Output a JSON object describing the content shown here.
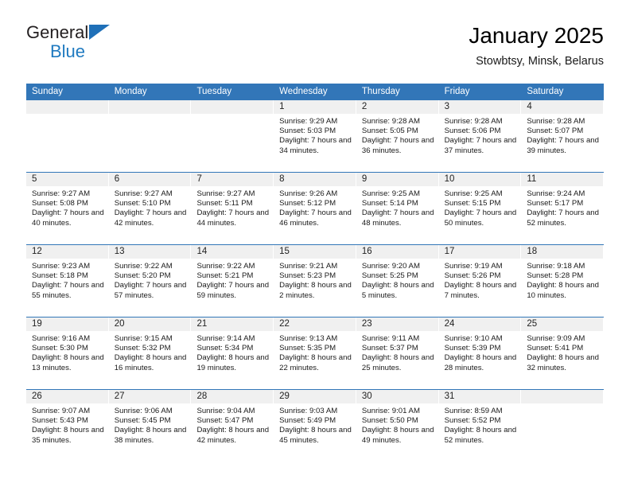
{
  "brand": {
    "name_top": "General",
    "name_bottom": "Blue",
    "logo_icon": "triangle-flag-icon",
    "accent_color": "#1f7ac0"
  },
  "header": {
    "title": "January 2025",
    "subtitle": "Stowbtsy, Minsk, Belarus"
  },
  "colors": {
    "header_blue": "#3276b8",
    "daynum_band": "#f0f0f0",
    "text": "#1a1a1a"
  },
  "calendar": {
    "weekday_headers": [
      "Sunday",
      "Monday",
      "Tuesday",
      "Wednesday",
      "Thursday",
      "Friday",
      "Saturday"
    ],
    "weeks": [
      [
        {
          "day": "",
          "lines": []
        },
        {
          "day": "",
          "lines": []
        },
        {
          "day": "",
          "lines": []
        },
        {
          "day": "1",
          "lines": [
            "Sunrise: 9:29 AM",
            "Sunset: 5:03 PM",
            "Daylight: 7 hours and 34 minutes."
          ]
        },
        {
          "day": "2",
          "lines": [
            "Sunrise: 9:28 AM",
            "Sunset: 5:05 PM",
            "Daylight: 7 hours and 36 minutes."
          ]
        },
        {
          "day": "3",
          "lines": [
            "Sunrise: 9:28 AM",
            "Sunset: 5:06 PM",
            "Daylight: 7 hours and 37 minutes."
          ]
        },
        {
          "day": "4",
          "lines": [
            "Sunrise: 9:28 AM",
            "Sunset: 5:07 PM",
            "Daylight: 7 hours and 39 minutes."
          ]
        }
      ],
      [
        {
          "day": "5",
          "lines": [
            "Sunrise: 9:27 AM",
            "Sunset: 5:08 PM",
            "Daylight: 7 hours and 40 minutes."
          ]
        },
        {
          "day": "6",
          "lines": [
            "Sunrise: 9:27 AM",
            "Sunset: 5:10 PM",
            "Daylight: 7 hours and 42 minutes."
          ]
        },
        {
          "day": "7",
          "lines": [
            "Sunrise: 9:27 AM",
            "Sunset: 5:11 PM",
            "Daylight: 7 hours and 44 minutes."
          ]
        },
        {
          "day": "8",
          "lines": [
            "Sunrise: 9:26 AM",
            "Sunset: 5:12 PM",
            "Daylight: 7 hours and 46 minutes."
          ]
        },
        {
          "day": "9",
          "lines": [
            "Sunrise: 9:25 AM",
            "Sunset: 5:14 PM",
            "Daylight: 7 hours and 48 minutes."
          ]
        },
        {
          "day": "10",
          "lines": [
            "Sunrise: 9:25 AM",
            "Sunset: 5:15 PM",
            "Daylight: 7 hours and 50 minutes."
          ]
        },
        {
          "day": "11",
          "lines": [
            "Sunrise: 9:24 AM",
            "Sunset: 5:17 PM",
            "Daylight: 7 hours and 52 minutes."
          ]
        }
      ],
      [
        {
          "day": "12",
          "lines": [
            "Sunrise: 9:23 AM",
            "Sunset: 5:18 PM",
            "Daylight: 7 hours and 55 minutes."
          ]
        },
        {
          "day": "13",
          "lines": [
            "Sunrise: 9:22 AM",
            "Sunset: 5:20 PM",
            "Daylight: 7 hours and 57 minutes."
          ]
        },
        {
          "day": "14",
          "lines": [
            "Sunrise: 9:22 AM",
            "Sunset: 5:21 PM",
            "Daylight: 7 hours and 59 minutes."
          ]
        },
        {
          "day": "15",
          "lines": [
            "Sunrise: 9:21 AM",
            "Sunset: 5:23 PM",
            "Daylight: 8 hours and 2 minutes."
          ]
        },
        {
          "day": "16",
          "lines": [
            "Sunrise: 9:20 AM",
            "Sunset: 5:25 PM",
            "Daylight: 8 hours and 5 minutes."
          ]
        },
        {
          "day": "17",
          "lines": [
            "Sunrise: 9:19 AM",
            "Sunset: 5:26 PM",
            "Daylight: 8 hours and 7 minutes."
          ]
        },
        {
          "day": "18",
          "lines": [
            "Sunrise: 9:18 AM",
            "Sunset: 5:28 PM",
            "Daylight: 8 hours and 10 minutes."
          ]
        }
      ],
      [
        {
          "day": "19",
          "lines": [
            "Sunrise: 9:16 AM",
            "Sunset: 5:30 PM",
            "Daylight: 8 hours and 13 minutes."
          ]
        },
        {
          "day": "20",
          "lines": [
            "Sunrise: 9:15 AM",
            "Sunset: 5:32 PM",
            "Daylight: 8 hours and 16 minutes."
          ]
        },
        {
          "day": "21",
          "lines": [
            "Sunrise: 9:14 AM",
            "Sunset: 5:34 PM",
            "Daylight: 8 hours and 19 minutes."
          ]
        },
        {
          "day": "22",
          "lines": [
            "Sunrise: 9:13 AM",
            "Sunset: 5:35 PM",
            "Daylight: 8 hours and 22 minutes."
          ]
        },
        {
          "day": "23",
          "lines": [
            "Sunrise: 9:11 AM",
            "Sunset: 5:37 PM",
            "Daylight: 8 hours and 25 minutes."
          ]
        },
        {
          "day": "24",
          "lines": [
            "Sunrise: 9:10 AM",
            "Sunset: 5:39 PM",
            "Daylight: 8 hours and 28 minutes."
          ]
        },
        {
          "day": "25",
          "lines": [
            "Sunrise: 9:09 AM",
            "Sunset: 5:41 PM",
            "Daylight: 8 hours and 32 minutes."
          ]
        }
      ],
      [
        {
          "day": "26",
          "lines": [
            "Sunrise: 9:07 AM",
            "Sunset: 5:43 PM",
            "Daylight: 8 hours and 35 minutes."
          ]
        },
        {
          "day": "27",
          "lines": [
            "Sunrise: 9:06 AM",
            "Sunset: 5:45 PM",
            "Daylight: 8 hours and 38 minutes."
          ]
        },
        {
          "day": "28",
          "lines": [
            "Sunrise: 9:04 AM",
            "Sunset: 5:47 PM",
            "Daylight: 8 hours and 42 minutes."
          ]
        },
        {
          "day": "29",
          "lines": [
            "Sunrise: 9:03 AM",
            "Sunset: 5:49 PM",
            "Daylight: 8 hours and 45 minutes."
          ]
        },
        {
          "day": "30",
          "lines": [
            "Sunrise: 9:01 AM",
            "Sunset: 5:50 PM",
            "Daylight: 8 hours and 49 minutes."
          ]
        },
        {
          "day": "31",
          "lines": [
            "Sunrise: 8:59 AM",
            "Sunset: 5:52 PM",
            "Daylight: 8 hours and 52 minutes."
          ]
        },
        {
          "day": "",
          "lines": []
        }
      ]
    ]
  }
}
